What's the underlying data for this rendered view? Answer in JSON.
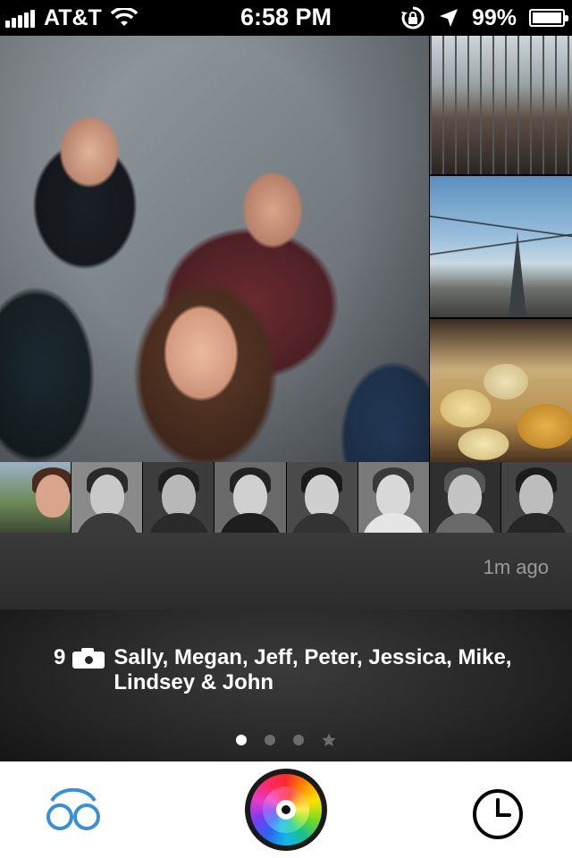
{
  "status_bar": {
    "carrier": "AT&T",
    "time": "6:58 PM",
    "battery_percent": "99%",
    "battery_level": 0.99,
    "icons": [
      "signal-icon",
      "wifi-icon",
      "rotation-lock-icon",
      "location-arrow-icon",
      "battery-icon"
    ]
  },
  "moment": {
    "time_ago": "1m ago",
    "photo_count": "9",
    "people_line1": "Sally, Megan, Jeff, Peter, Jessica, Mike,",
    "people_line2": "Lindsey & John"
  },
  "pager": {
    "total_dots": 3,
    "active_index": 0,
    "extra_icon": "star-icon"
  },
  "tab_bar": {
    "left_icon": "friends-infinity-icon",
    "center_icon": "color-wheel-camera-icon",
    "right_icon": "clock-icon"
  },
  "colors": {
    "tab_left_accent": "#3a8fd6",
    "background": "#1a1a1a",
    "tab_background": "#ffffff"
  }
}
